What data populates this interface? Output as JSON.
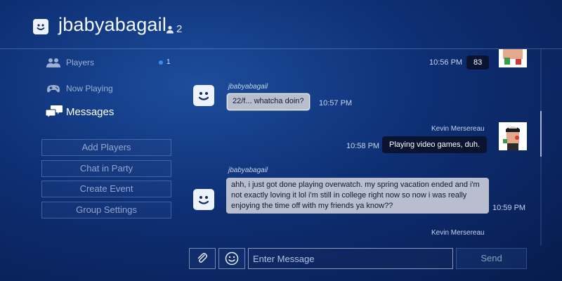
{
  "header": {
    "title": "jbabyabagail",
    "member_count": "2"
  },
  "sidebar": {
    "players": {
      "label": "Players",
      "badge": "1"
    },
    "now_playing": {
      "label": "Now Playing"
    },
    "messages": {
      "label": "Messages"
    },
    "buttons": [
      "Add Players",
      "Chat in Party",
      "Create Event",
      "Group Settings"
    ]
  },
  "messages": [
    {
      "from": "",
      "text": "83",
      "time": "10:56 PM",
      "direction": "out"
    },
    {
      "from": "jbabyabagail",
      "text": "22/f... whatcha doin?",
      "time": "10:57 PM",
      "direction": "in"
    },
    {
      "from": "Kevin Mersereau",
      "text": "Playing video games, duh.",
      "time": "10:58 PM",
      "direction": "out"
    },
    {
      "from": "jbabyabagail",
      "text": "ahh, i just got done playing overwatch. my spring vacation ended and i'm not exactly loving it lol i'm still in college right now so now i was really enjoying the time off with my friends ya know??",
      "time": "10:59 PM",
      "direction": "in"
    },
    {
      "from": "Kevin Mersereau",
      "text": "",
      "time": "",
      "direction": "out"
    }
  ],
  "composer": {
    "placeholder": "Enter Message",
    "send_label": "Send"
  },
  "colors": {
    "background": "#0e2f74",
    "bubble_in": "#b8bece",
    "bubble_out": "#0a1430",
    "badge_dot": "#3a8cf0"
  }
}
